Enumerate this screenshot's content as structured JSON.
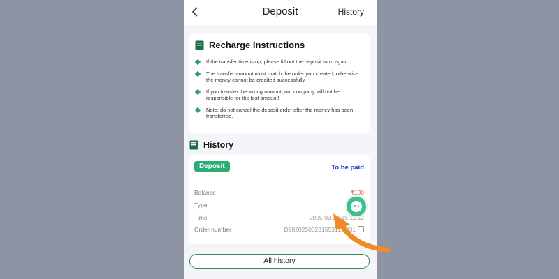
{
  "header": {
    "title": "Deposit",
    "history_label": "History"
  },
  "instructions": {
    "title": "Recharge instructions",
    "items": [
      "If the transfer time is up, please fill out the deposit form again.",
      "The transfer amount must match the order you created, otherwise the money cannot be credited successfully.",
      "If you transfer the wrong amount, our company will not be responsible for the lost amount!",
      "Note: do not cancel the deposit order after the money has been transferred."
    ]
  },
  "history": {
    "title": "History",
    "record": {
      "badge": "Deposit",
      "status": "To be paid",
      "rows": [
        {
          "label": "Balance",
          "value": "₹100"
        },
        {
          "label": "Type",
          "value": ""
        },
        {
          "label": "Time",
          "value": "2025-03-23 15:11:12"
        },
        {
          "label": "Order number",
          "value": "D9820250323155311...031"
        }
      ]
    },
    "all_history_label": "All history"
  },
  "colors": {
    "accent_green": "#2bae74",
    "status_blue": "#1a2be0",
    "balance_red": "#e05a3a",
    "arrow_orange": "#f08a24"
  }
}
